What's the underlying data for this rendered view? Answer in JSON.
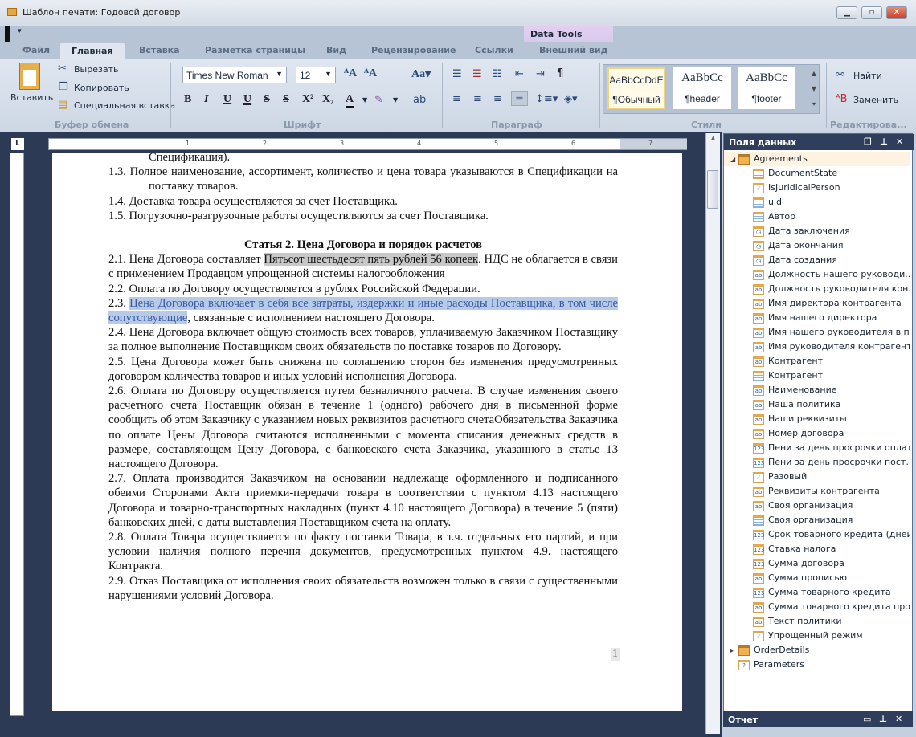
{
  "window": {
    "title": "Шаблон печати: Годовой договор",
    "controls": [
      "minimize",
      "maximize",
      "close"
    ]
  },
  "tabs": [
    {
      "label": "Файл",
      "active": false
    },
    {
      "label": "Главная",
      "active": true
    },
    {
      "label": "Вставка",
      "active": false
    },
    {
      "label": "Разметка страницы",
      "active": false
    },
    {
      "label": "Вид",
      "active": false
    },
    {
      "label": "Рецензирование",
      "active": false
    },
    {
      "label": "Ссылки",
      "active": false
    },
    {
      "label": "Внешний вид",
      "active": false
    }
  ],
  "context_tab": {
    "label": "Data Tools",
    "color": "#d9c6ee"
  },
  "ribbon": {
    "clipboard": {
      "label": "Буфер обмена",
      "paste": "Вставить",
      "cut": "Вырезать",
      "copy": "Копировать",
      "paste_special": "Специальная вставка"
    },
    "font": {
      "label": "Шрифт",
      "font_name": "Times New Roman",
      "font_size": "12"
    },
    "paragraph": {
      "label": "Параграф"
    },
    "styles": {
      "label": "Стили",
      "items": [
        {
          "preview": "AaBbCcDdE",
          "name": "¶Обычный",
          "selected": true
        },
        {
          "preview": "AaBbCc",
          "name": "¶header"
        },
        {
          "preview": "AaBbCc",
          "name": "¶footer"
        }
      ]
    },
    "editing": {
      "label": "Редактирова...",
      "find": "Найти",
      "replace": "Заменить"
    }
  },
  "ruler": {
    "marks": [
      "1",
      "2",
      "3",
      "4",
      "5",
      "6",
      "7"
    ]
  },
  "document": {
    "paragraphs": [
      {
        "style": "first-cont",
        "segments": [
          {
            "t": "Спецификация)."
          }
        ]
      },
      {
        "style": "hang",
        "segments": [
          {
            "t": "1.3.  Полное наименование,  ассортимент, количество и цена товара указываются в Спецификации на поставку товаров."
          }
        ]
      },
      {
        "style": "",
        "segments": [
          {
            "t": "1.4. Доставка товара осуществляется за счет Поставщика."
          }
        ]
      },
      {
        "style": "",
        "segments": [
          {
            "t": "1.5. Погрузочно-разгрузочные работы осуществляются за счет Поставщика."
          }
        ]
      },
      {
        "style": "heading",
        "segments": [
          {
            "t": "Статья 2.  Цена Договора и порядок расчетов"
          }
        ]
      },
      {
        "style": "",
        "segments": [
          {
            "t": "2.1.  Цена Договора составляет "
          },
          {
            "t": "Пятьсот шестьдесят пять рублей 56 копеек",
            "hl": "gray"
          },
          {
            "t": ". НДС не облагается в связи с применением Продавцом упрощенной системы налогообложения"
          }
        ]
      },
      {
        "style": "",
        "segments": [
          {
            "t": "2.2.  Оплата по Договору осуществляется в рублях Российской Федерации."
          }
        ]
      },
      {
        "style": "",
        "segments": [
          {
            "t": "2.3.  "
          },
          {
            "t": "Цена Договора включает в себя все затраты, издержки и иные расходы Поставщика, в том числе сопутствующие",
            "hl": "blue"
          },
          {
            "t": ", связанные с исполнением настоящего Договора."
          }
        ]
      },
      {
        "style": "",
        "segments": [
          {
            "t": "2.4. Цена Договора включает общую стоимость всех товаров, уплачиваемую Заказчиком Поставщику за полное выполнение Поставщиком своих обязательств по поставке товаров по Договору."
          }
        ]
      },
      {
        "style": "",
        "segments": [
          {
            "t": "2.5. Цена Договора может быть снижена по соглашению сторон без изменения предусмотренных договором количества товаров и иных условий исполнения Договора."
          }
        ]
      },
      {
        "style": "",
        "segments": [
          {
            "t": "2.6. Оплата по Договору осуществляется путем безналичного расчета. В случае изменения своего расчетного счета Поставщик обязан в течение 1 (одного) рабочего дня в письменной форме сообщить об этом Заказчику с указанием новых реквизитов расчетного счетаОбязательства Заказчика по оплате Цены Договора считаются исполненными с момента списания денежных средств в размере, составляющем Цену Договора, с банковского счета Заказчика, указанного в статье 13 настоящего Договора."
          }
        ]
      },
      {
        "style": "",
        "segments": [
          {
            "t": "2.7. Оплата производится Заказчиком на основании надлежаще оформленного и подписанного обеими Сторонами Акта приемки-передачи товара в соответствии с пунктом 4.13 настоящего Договора и товарно-транспортных накладных (пункт 4.10 настоящего Договора) в течение 5 (пяти) банковских дней, с даты выставления Поставщиком счета на оплату."
          }
        ]
      },
      {
        "style": "",
        "segments": [
          {
            "t": "2.8.  Оплата Товара осуществляется по факту поставки Товара, в т.ч. отдельных его партий, и при условии наличия полного перечня документов, предусмотренных пунктом 4.9. настоящего Контракта."
          }
        ]
      },
      {
        "style": "",
        "segments": [
          {
            "t": "2.9. Отказ Поставщика от исполнения своих обязательств возможен только в связи с существенными нарушениями условий Договора."
          }
        ]
      }
    ],
    "page_number": "1"
  },
  "fields_panel": {
    "title": "Поля данных",
    "nodes": [
      {
        "label": "Agreements",
        "icon": "datasource",
        "level": 0,
        "expanded": true
      },
      {
        "label": "DocumentState",
        "icon": "table",
        "level": 1
      },
      {
        "label": "IsJuridicalPerson",
        "icon": "check",
        "level": 1
      },
      {
        "label": "uid",
        "icon": "table",
        "level": 1
      },
      {
        "label": "Автор",
        "icon": "table",
        "level": 1
      },
      {
        "label": "Дата заключения",
        "icon": "clock",
        "level": 1
      },
      {
        "label": "Дата окончания",
        "icon": "clock",
        "level": 1
      },
      {
        "label": "Дата создания",
        "icon": "clock",
        "level": 1
      },
      {
        "label": "Должность нашего руководи...",
        "icon": "ab",
        "level": 1
      },
      {
        "label": "Должность руководителя кон...",
        "icon": "ab",
        "level": 1
      },
      {
        "label": "Имя директора контрагента",
        "icon": "ab",
        "level": 1
      },
      {
        "label": "Имя нашего директора",
        "icon": "ab",
        "level": 1
      },
      {
        "label": "Имя нашего руководителя в п...",
        "icon": "ab",
        "level": 1
      },
      {
        "label": "Имя руководителя контрагента",
        "icon": "ab",
        "level": 1
      },
      {
        "label": "Контрагент",
        "icon": "ab",
        "level": 1
      },
      {
        "label": "Контрагент",
        "icon": "table",
        "level": 1
      },
      {
        "label": "Наименование",
        "icon": "ab",
        "level": 1
      },
      {
        "label": "Наша политика",
        "icon": "ab",
        "level": 1
      },
      {
        "label": "Наши реквизиты",
        "icon": "ab",
        "level": 1
      },
      {
        "label": "Номер договора",
        "icon": "ab",
        "level": 1
      },
      {
        "label": "Пени за день просрочки оплаты",
        "icon": "123",
        "level": 1
      },
      {
        "label": "Пени за день просрочки пост...",
        "icon": "123",
        "level": 1
      },
      {
        "label": "Разовый",
        "icon": "check",
        "level": 1
      },
      {
        "label": "Реквизиты контрагента",
        "icon": "ab",
        "level": 1
      },
      {
        "label": "Своя организация",
        "icon": "ab",
        "level": 1
      },
      {
        "label": "Своя организация",
        "icon": "table",
        "level": 1
      },
      {
        "label": "Срок товарного кредита (дней)",
        "icon": "123",
        "level": 1
      },
      {
        "label": "Ставка налога",
        "icon": "123",
        "level": 1
      },
      {
        "label": "Сумма договора",
        "icon": "123",
        "level": 1
      },
      {
        "label": "Сумма прописью",
        "icon": "ab",
        "level": 1
      },
      {
        "label": "Сумма товарного кредита",
        "icon": "123",
        "level": 1
      },
      {
        "label": "Сумма товарного кредита про...",
        "icon": "ab",
        "level": 1
      },
      {
        "label": "Текст политики",
        "icon": "ab",
        "level": 1
      },
      {
        "label": "Упрощенный режим",
        "icon": "check",
        "level": 1
      },
      {
        "label": "OrderDetails",
        "icon": "datasource",
        "level": 0,
        "expanded": false
      },
      {
        "label": "Parameters",
        "icon": "question",
        "level": 0
      }
    ]
  },
  "report_panel": {
    "title": "Отчет"
  }
}
